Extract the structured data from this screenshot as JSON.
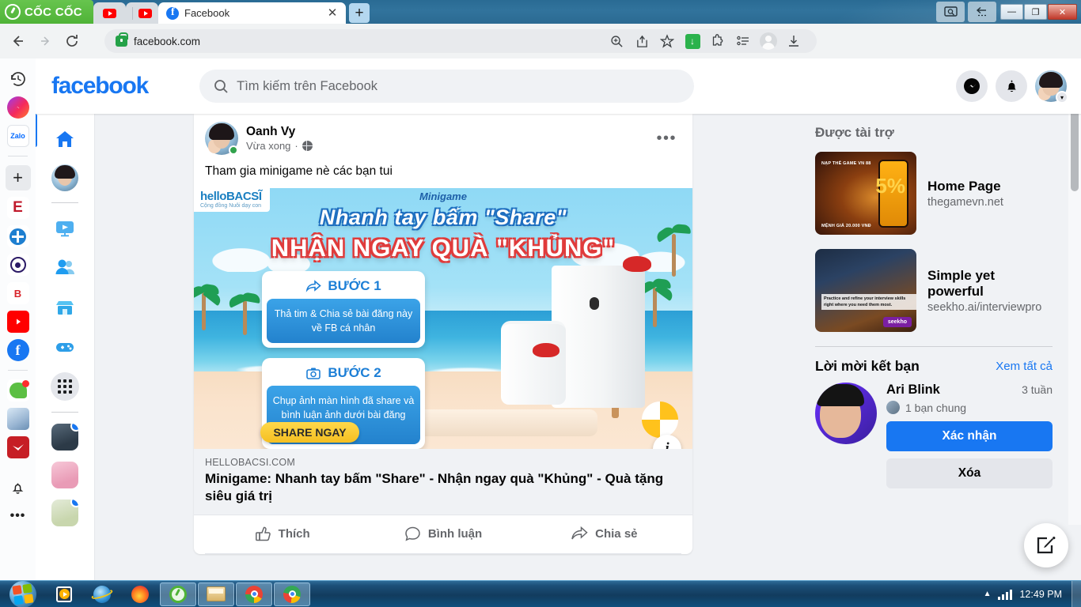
{
  "browser": {
    "brand": "CỐC CỐC",
    "tabs": [
      {
        "title": "",
        "icon": "youtube-icon",
        "active": false,
        "pinned": true
      },
      {
        "title": "",
        "icon": "youtube-icon",
        "active": false,
        "pinned": true
      },
      {
        "title": "Facebook",
        "icon": "facebook-icon",
        "active": true,
        "pinned": false
      }
    ],
    "newtab_label": "+",
    "close_label": "✕",
    "url": "facebook.com",
    "window_controls": {
      "minimize": "—",
      "maximize": "❐",
      "close": "✕"
    }
  },
  "facebook": {
    "logo": "facebook",
    "search": {
      "placeholder": "Tìm kiếm trên Facebook",
      "value": ""
    },
    "post": {
      "author": "Oanh Vy",
      "time": "Vừa xong",
      "separator": "·",
      "text": "Tham gia minigame nè các bạn tui",
      "menu": "•••",
      "link_card": {
        "domain": "HELLOBACSI.COM",
        "title": "Minigame: Nhanh tay bấm \"Share\" - Nhận ngay quà \"Khủng\" - Quà tặng siêu giá trị"
      },
      "ad_image": {
        "brand": "helloBACSĨ",
        "brand_sub": "Cộng đồng Nuôi dạy con",
        "minigame_label": "Minigame",
        "headline1": "Nhanh tay bấm \"Share\"",
        "headline2": "NHẬN NGAY QUÀ \"KHỦNG\"",
        "step1_title": "BƯỚC 1",
        "step1_body": "Thả tim & Chia sẻ bài đăng này về FB cá nhân",
        "step2_title": "BƯỚC 2",
        "step2_body": "Chụp ảnh màn hình đã share và bình luận ảnh dưới bài đăng này.",
        "cta": "SHARE NGAY",
        "info": "i"
      },
      "actions": [
        {
          "label": "Thích",
          "icon": "thumbs-up-icon"
        },
        {
          "label": "Bình luận",
          "icon": "comment-icon"
        },
        {
          "label": "Chia sẻ",
          "icon": "share-icon"
        }
      ]
    },
    "sponsored": {
      "title": "Được tài trợ",
      "items": [
        {
          "name": "Home Page",
          "url": "thegamevn.net",
          "thumb_line1": "NẠP THẺ GAME VN 88",
          "thumb_line2": "MỆNH GIÁ 20.000 VNĐ",
          "thumb_pct": "5%"
        },
        {
          "name": "Simple yet powerful",
          "url": "seekho.ai/interviewpro",
          "thumb_caption": "Practice and refine your interview skills right where you need them most.",
          "thumb_badge": "seekho"
        }
      ]
    },
    "friend_requests": {
      "title": "Lời mời kết bạn",
      "see_all": "Xem tất cả",
      "items": [
        {
          "name": "Ari Blink",
          "time": "3 tuần",
          "mutual": "1 bạn chung",
          "confirm": "Xác nhận",
          "delete": "Xóa"
        }
      ]
    }
  },
  "taskbar": {
    "clock": "12:49 PM",
    "items": [
      "media-player-icon",
      "internet-explorer-icon",
      "firefox-icon",
      "coccoc-icon",
      "file-explorer-icon",
      "chrome-icon",
      "chrome-icon"
    ]
  },
  "colors": {
    "fb_blue": "#1877f2",
    "fb_bg": "#f0f2f5",
    "coccoc_green": "#5cbf43",
    "accent_red": "#e03b3b"
  }
}
